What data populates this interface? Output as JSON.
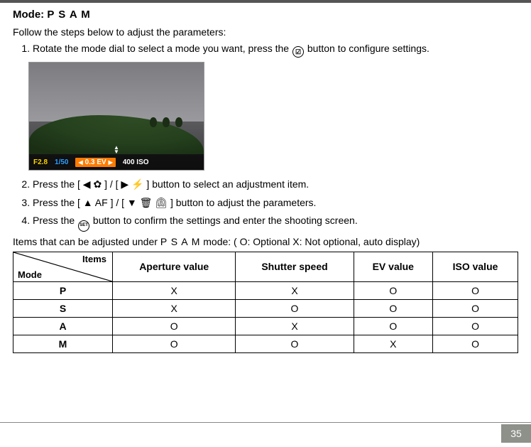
{
  "heading_prefix": "Mode:",
  "heading_psam": "P S A M",
  "intro": "Follow the steps below to adjust the parameters:",
  "steps": {
    "s1a": "Rotate the mode dial to select a mode you want, press the ",
    "s1b": " button to configure settings.",
    "s1_icon": "☑",
    "s2a": "Press the ",
    "s2_bracket": "[ ◀ ✿ ] / [ ▶ ⚡ ]",
    "s2b": " button to select an adjustment item.",
    "s3a": "Press the ",
    "s3_bracket": "[ ▲ AF ] / [ ▼ 🗑 ⏲ ]",
    "s3b": " button to adjust the parameters.",
    "s4a": "Press the ",
    "s4_icon": "SET",
    "s4b": " button to confirm the settings and enter the shooting screen."
  },
  "sample": {
    "aperture": "F2.8",
    "shutter": "1/50",
    "ev": "0.3 EV",
    "iso": "400 ISO",
    "tri_left": "◀",
    "tri_right": "▶",
    "tri_up": "▲",
    "tri_down": "▼"
  },
  "caption_a": "Items that can be adjusted under ",
  "caption_psam": "P S A M",
  "caption_b": " mode: ( O: Optional X: Not optional, auto display)",
  "table": {
    "corner_items": "Items",
    "corner_mode": "Mode",
    "headers": [
      "Aperture value",
      "Shutter speed",
      "EV value",
      "ISO value"
    ],
    "rows": [
      {
        "mode": "P",
        "vals": [
          "X",
          "X",
          "O",
          "O"
        ]
      },
      {
        "mode": "S",
        "vals": [
          "X",
          "O",
          "O",
          "O"
        ]
      },
      {
        "mode": "A",
        "vals": [
          "O",
          "X",
          "O",
          "O"
        ]
      },
      {
        "mode": "M",
        "vals": [
          "O",
          "O",
          "X",
          "O"
        ]
      }
    ]
  },
  "page_number": "35"
}
